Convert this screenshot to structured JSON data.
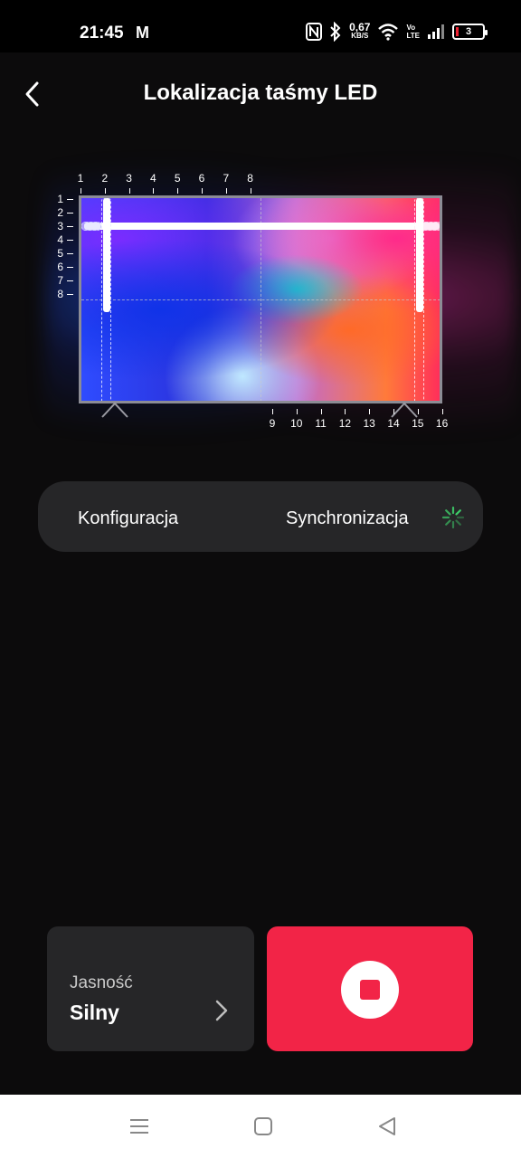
{
  "status_bar": {
    "time": "21:45",
    "mail_glyph": "M",
    "speed_value": "0,67",
    "speed_unit": "KB/S",
    "volte_top": "Vo",
    "volte_bottom": "LTE",
    "battery_level": "3"
  },
  "header": {
    "title": "Lokalizacja taśmy LED",
    "back_icon": "chevron-left-icon"
  },
  "tv_diagram": {
    "top_ticks": [
      "1",
      "2",
      "3",
      "4",
      "5",
      "6",
      "7",
      "8"
    ],
    "left_ticks": [
      "1",
      "2",
      "3",
      "4",
      "5",
      "6",
      "7",
      "8"
    ],
    "bottom_ticks": [
      "9",
      "10",
      "11",
      "12",
      "13",
      "14",
      "15",
      "16"
    ]
  },
  "control": {
    "config_label": "Konfiguracja",
    "sync_label": "Synchronizacja",
    "spinner_color": "#3ecf6a"
  },
  "brightness": {
    "label": "Jasność",
    "value": "Silny"
  },
  "stop_button": {
    "color": "#f22447",
    "icon": "stop-icon"
  },
  "nav_bar": {
    "icons": [
      "menu-icon",
      "home-icon",
      "back-triangle-icon"
    ]
  }
}
